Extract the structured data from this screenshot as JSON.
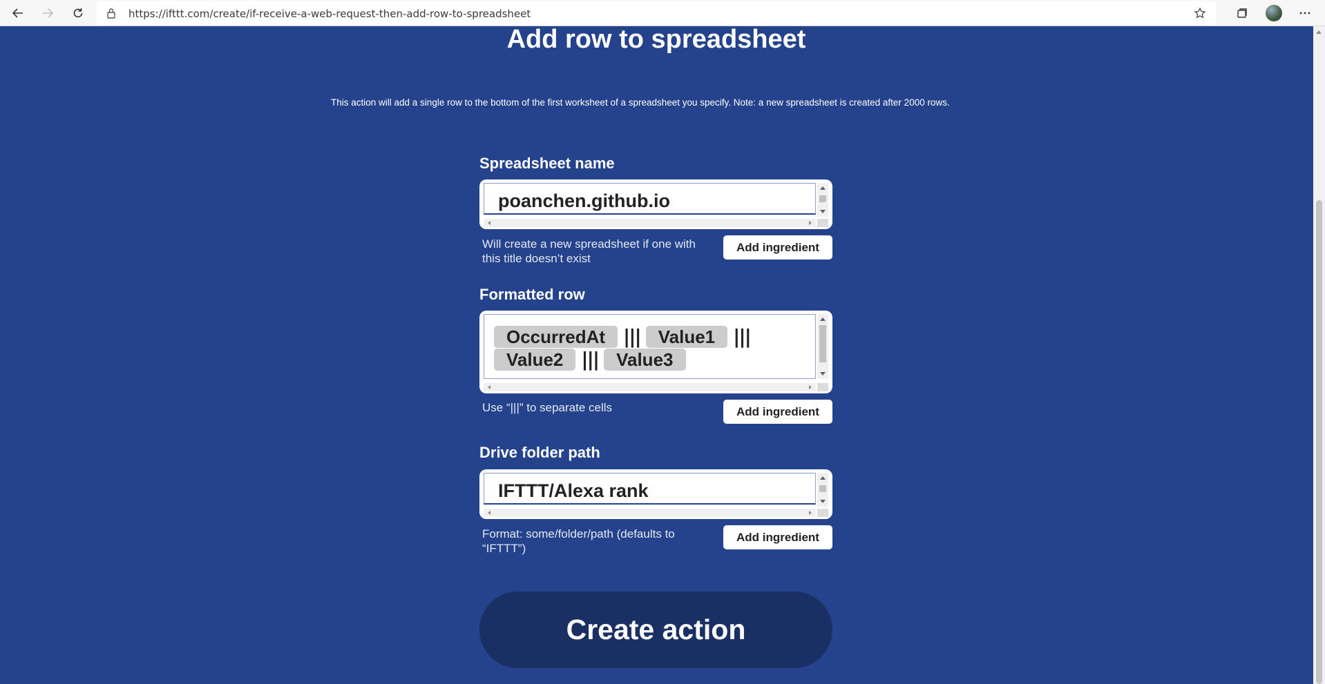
{
  "browser": {
    "url": "https://ifttt.com/create/if-receive-a-web-request-then-add-row-to-spreadsheet"
  },
  "page": {
    "title": "Add row to spreadsheet",
    "description": "This action will add a single row to the bottom of the first worksheet of a spreadsheet you specify. Note: a new spreadsheet is created after 2000 rows."
  },
  "fields": {
    "spreadsheet_name": {
      "label": "Spreadsheet name",
      "value": "poanchen.github.io",
      "hint": "Will create a new spreadsheet if one with this title doesn’t exist",
      "button": "Add ingredient"
    },
    "formatted_row": {
      "label": "Formatted row",
      "line1": [
        {
          "type": "ingredient",
          "text": "OccurredAt"
        },
        {
          "type": "separator",
          "text": "|||"
        },
        {
          "type": "ingredient",
          "text": "Value1"
        },
        {
          "type": "separator",
          "text": "|||"
        }
      ],
      "line2": [
        {
          "type": "ingredient",
          "text": "Value2"
        },
        {
          "type": "separator",
          "text": "|||"
        },
        {
          "type": "ingredient",
          "text": "Value3"
        }
      ],
      "hint": "Use “|||” to separate cells",
      "button": "Add ingredient"
    },
    "drive_folder_path": {
      "label": "Drive folder path",
      "value": "IFTTT/Alexa rank",
      "hint": "Format: some/folder/path (defaults to “IFTTT”)",
      "button": "Add ingredient"
    }
  },
  "create_button": "Create action",
  "colors": {
    "background": "#24438c",
    "create_button": "#1a2f63",
    "ingredient_pill": "#cccccc"
  }
}
